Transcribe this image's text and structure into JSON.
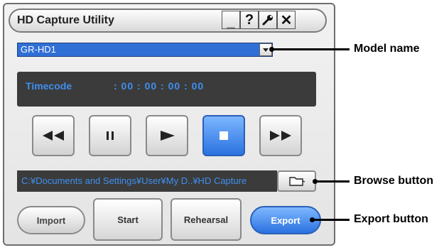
{
  "window": {
    "title": "HD Capture Utility",
    "controls": [
      {
        "name": "minimize",
        "glyph": "_"
      },
      {
        "name": "help",
        "glyph": "?"
      },
      {
        "name": "settings",
        "glyph": "wrench"
      },
      {
        "name": "close",
        "glyph": "✕"
      }
    ]
  },
  "model": {
    "selected": "GR-HD1"
  },
  "timecode": {
    "label": "Timecode",
    "value": ": 00 : 00 : 00 : 00"
  },
  "transport": {
    "buttons": [
      "rewind",
      "pause",
      "play",
      "stop",
      "fast-forward"
    ],
    "active": "stop"
  },
  "path": {
    "value": "C:¥Documents and Settings¥User¥My D..¥HD Capture"
  },
  "actions": {
    "import_label": "Import",
    "start_label": "Start",
    "rehearsal_label": "Rehearsal",
    "export_label": "Export"
  },
  "callouts": {
    "model_name": "Model name",
    "browse_button": "Browse button",
    "export_button": "Export button"
  },
  "colors": {
    "accent_blue": "#2a72e0",
    "timecode_text": "#3f8ff0",
    "dark_panel": "#3b3b3b"
  }
}
